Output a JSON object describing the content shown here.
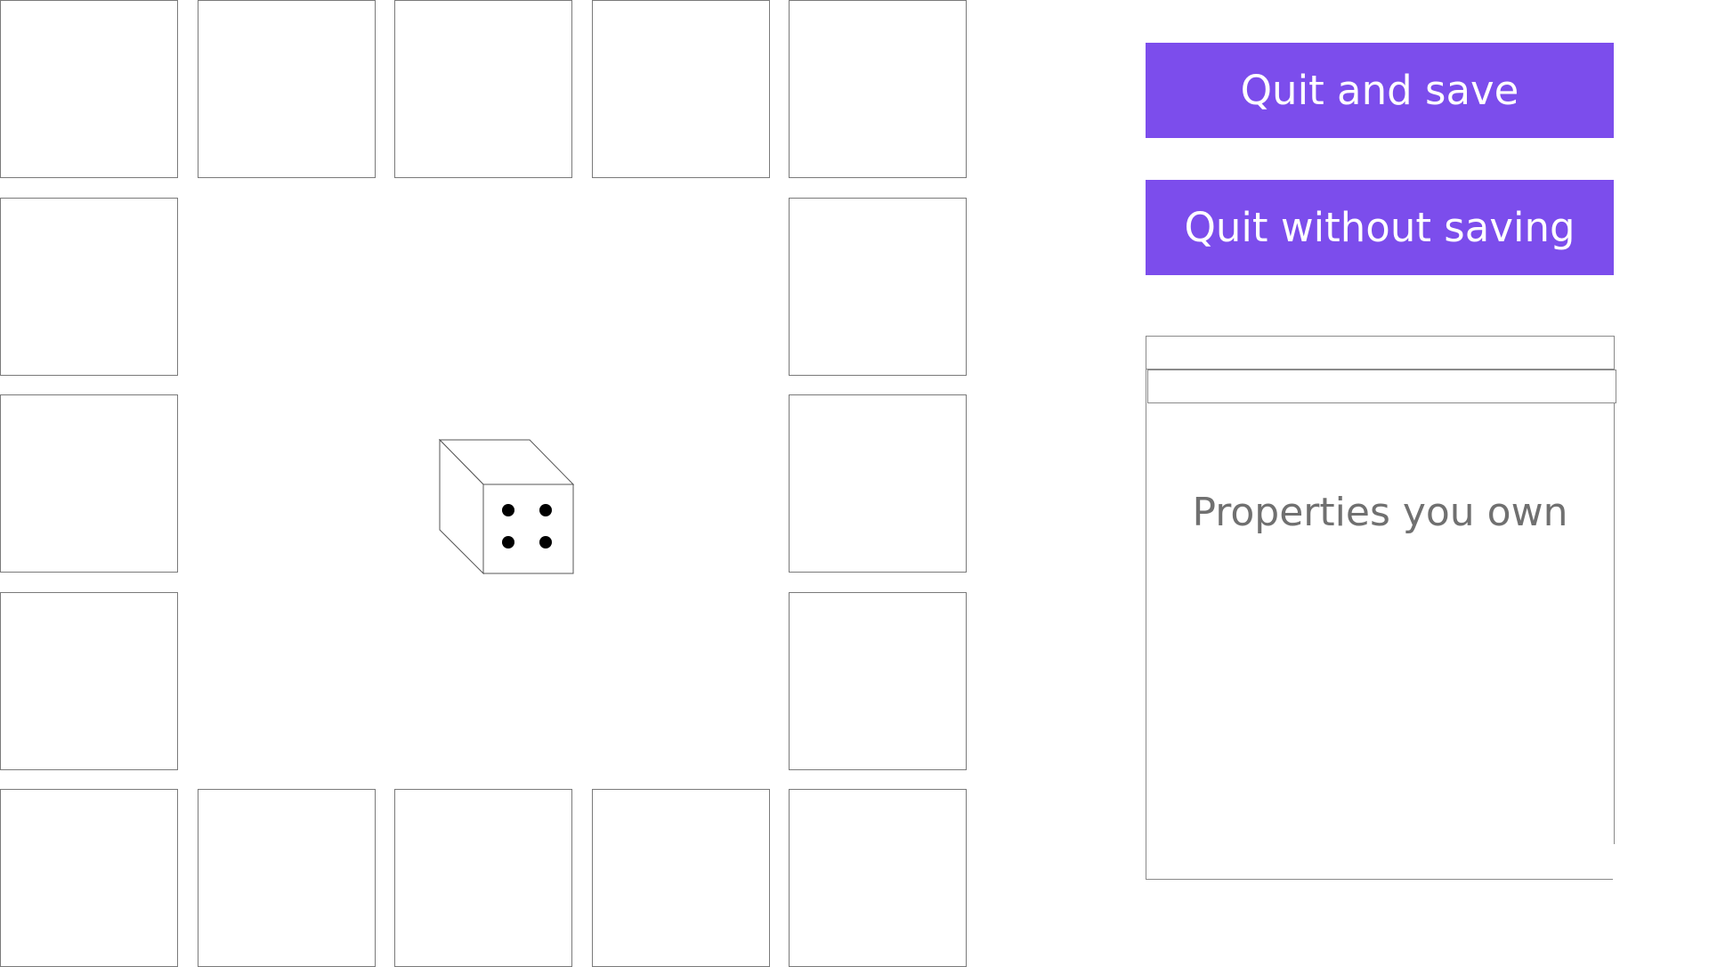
{
  "buttons": {
    "quit_save": "Quit and save",
    "quit_no_save": "Quit without saving"
  },
  "properties_panel": {
    "title": "Properties you own",
    "input_value": ""
  },
  "dice": {
    "face_value": 4
  },
  "board": {
    "tile_count": 16
  },
  "colors": {
    "button_bg": "#7c4dec",
    "button_text": "#ffffff",
    "panel_text": "#707070"
  }
}
